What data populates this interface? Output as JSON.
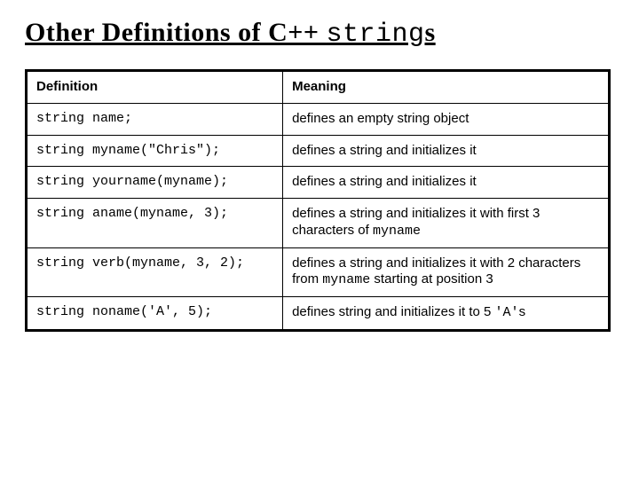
{
  "title_prefix": "Other Definitions of C++ ",
  "title_mono": "string",
  "title_suffix": "s",
  "headers": {
    "definition": "Definition",
    "meaning": "Meaning"
  },
  "rows": [
    {
      "definition": "string name;",
      "meaning_parts": [
        {
          "t": "text",
          "v": "defines an empty string object"
        }
      ]
    },
    {
      "definition": "string myname(\"Chris\");",
      "meaning_parts": [
        {
          "t": "text",
          "v": "defines a string and initializes it"
        }
      ]
    },
    {
      "definition": "string yourname(myname);",
      "meaning_parts": [
        {
          "t": "text",
          "v": "defines a string and initializes it"
        }
      ]
    },
    {
      "definition": "string aname(myname, 3);",
      "meaning_parts": [
        {
          "t": "text",
          "v": "defines a string and initializes it with first 3 characters of "
        },
        {
          "t": "code",
          "v": "myname"
        }
      ]
    },
    {
      "definition": "string verb(myname, 3, 2);",
      "meaning_parts": [
        {
          "t": "text",
          "v": "defines a string and initializes it with 2 characters from "
        },
        {
          "t": "code",
          "v": "myname"
        },
        {
          "t": "text",
          "v": " starting at position 3"
        }
      ]
    },
    {
      "definition": "string noname('A', 5);",
      "meaning_parts": [
        {
          "t": "text",
          "v": "defines string and initializes it to 5 "
        },
        {
          "t": "code",
          "v": "'A'"
        },
        {
          "t": "text",
          "v": "s"
        }
      ]
    }
  ]
}
